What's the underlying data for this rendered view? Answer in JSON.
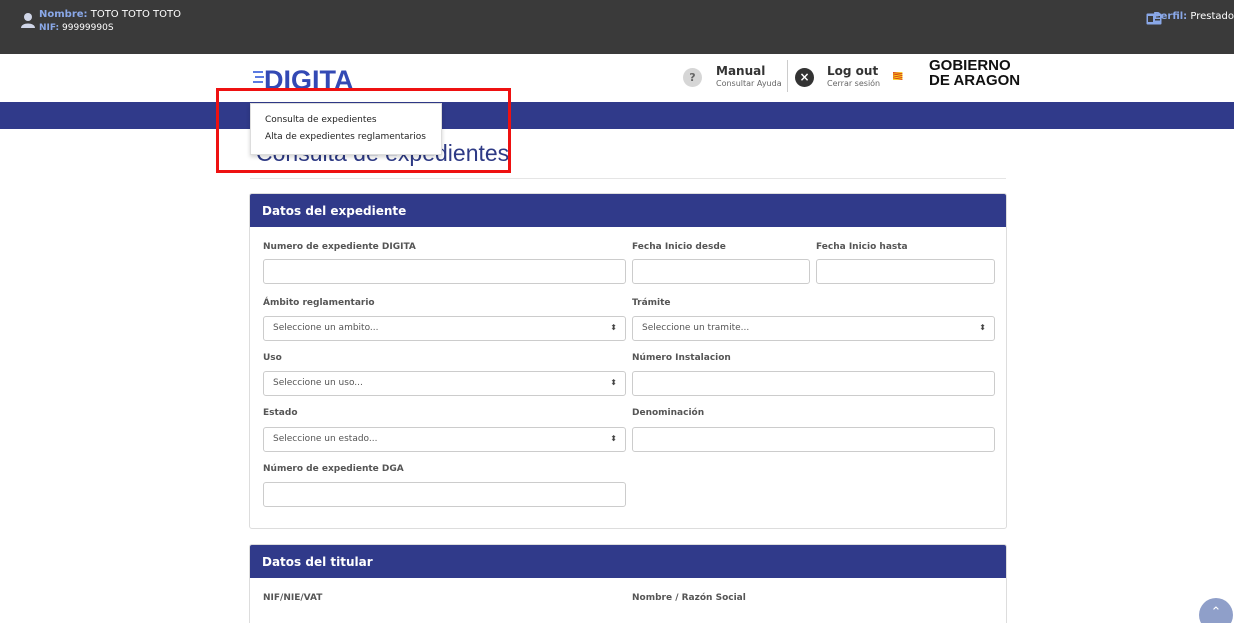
{
  "userbar": {
    "name_label": "Nombre:",
    "name_value": "TOTO TOTO TOTO",
    "nif_label": "NIF:",
    "nif_value": "99999990S",
    "perfil_label": "Perfil:",
    "perfil_value": "Prestado"
  },
  "header": {
    "logo_text": "DIGITA",
    "manual_title": "Manual",
    "manual_sub": "Consultar Ayuda",
    "logout_title": "Log out",
    "logout_sub": "Cerrar sesión",
    "gov_line1": "GOBIERNO",
    "gov_line2": "DE ARAGON"
  },
  "menu": {
    "items": [
      "Consulta de expedientes",
      "Alta de expedientes reglamentarios"
    ]
  },
  "page_title": "Consulta de expedientes",
  "panel1": {
    "title": "Datos del expediente",
    "numero_digita_label": "Numero de expediente DIGITA",
    "fecha_desde_label": "Fecha Inicio desde",
    "fecha_hasta_label": "Fecha Inicio hasta",
    "ambito_label": "Ámbito reglamentario",
    "ambito_placeholder": "Seleccione un ambito...",
    "tramite_label": "Trámite",
    "tramite_placeholder": "Seleccione un tramite...",
    "uso_label": "Uso",
    "uso_placeholder": "Seleccione un uso...",
    "instalacion_label": "Número Instalacion",
    "estado_label": "Estado",
    "estado_placeholder": "Seleccione un estado...",
    "denominacion_label": "Denominación",
    "numero_dga_label": "Número de expediente DGA"
  },
  "panel2": {
    "title": "Datos del titular",
    "nif_label": "NIF/NIE/VAT",
    "nombre_label": "Nombre / Razón Social"
  },
  "colors": {
    "brand_blue": "#303a8a",
    "highlight_red": "#e11111"
  }
}
